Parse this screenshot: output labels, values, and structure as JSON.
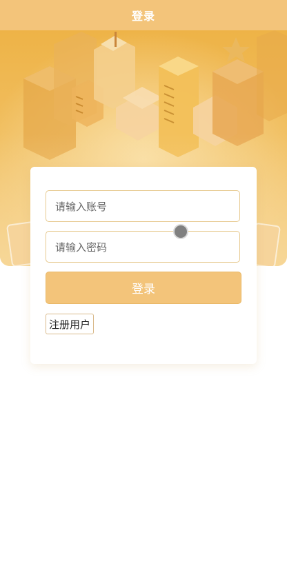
{
  "navbar": {
    "title": "登录"
  },
  "login_form": {
    "account_placeholder": "请输入账号",
    "password_placeholder": "请输入密码",
    "login_label": "登录",
    "register_label": "注册用户"
  },
  "colors": {
    "primary": "#f3c47a",
    "input_border": "#e6c88c",
    "hero_top": "#eeb347"
  }
}
